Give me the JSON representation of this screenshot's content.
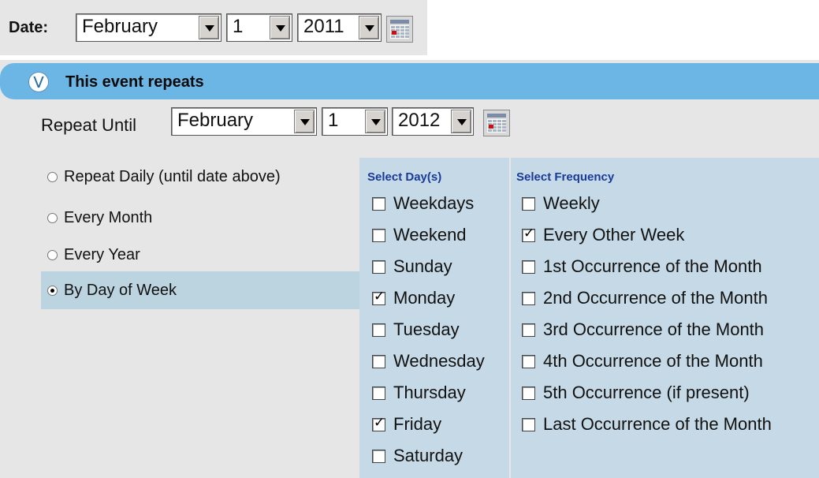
{
  "date": {
    "label": "Date:",
    "month": "February",
    "day": "1",
    "year": "2011"
  },
  "repeat_section": {
    "title": "This event repeats",
    "collapse_icon": "double-chevron-down-icon",
    "until_label": "Repeat Until",
    "until_month": "February",
    "until_day": "1",
    "until_year": "2012"
  },
  "repeat_options": [
    {
      "label": "Repeat Daily (until date above)",
      "selected": false
    },
    {
      "label": "Every Month",
      "selected": false
    },
    {
      "label": "Every Year",
      "selected": false
    },
    {
      "label": "By Day of Week",
      "selected": true
    }
  ],
  "days": {
    "title": "Select Day(s)",
    "items": [
      {
        "label": "Weekdays",
        "checked": false
      },
      {
        "label": "Weekend",
        "checked": false
      },
      {
        "label": "Sunday",
        "checked": false
      },
      {
        "label": "Monday",
        "checked": true
      },
      {
        "label": "Tuesday",
        "checked": false
      },
      {
        "label": "Wednesday",
        "checked": false
      },
      {
        "label": "Thursday",
        "checked": false
      },
      {
        "label": "Friday",
        "checked": true
      },
      {
        "label": "Saturday",
        "checked": false
      }
    ]
  },
  "frequency": {
    "title": "Select Frequency",
    "items": [
      {
        "label": "Weekly",
        "checked": false
      },
      {
        "label": "Every Other Week",
        "checked": true
      },
      {
        "label": "1st Occurrence of the Month",
        "checked": false
      },
      {
        "label": "2nd Occurrence of the Month",
        "checked": false
      },
      {
        "label": "3rd Occurrence of the Month",
        "checked": false
      },
      {
        "label": "4th Occurrence of the Month",
        "checked": false
      },
      {
        "label": "5th Occurrence (if present)",
        "checked": false
      },
      {
        "label": "Last Occurrence of the Month",
        "checked": false
      }
    ]
  },
  "colors": {
    "header_bar": "#6cb6e6",
    "panel_bg": "#e6e6e6",
    "checkbox_column_bg": "#c5dae6",
    "column_title": "#1a3a9a"
  }
}
